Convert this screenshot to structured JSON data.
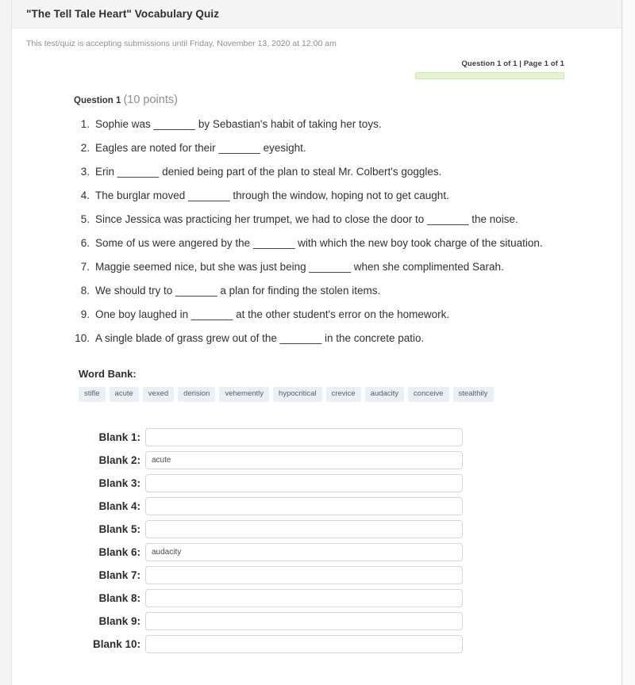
{
  "header": {
    "title": "\"The Tell Tale Heart\" Vocabulary Quiz",
    "submission_note": "This test/quiz is accepting submissions until Friday, November 13, 2020 at 12:00 am"
  },
  "progress": {
    "counter_label": "Question 1 of 1 | Page 1 of 1",
    "percent": 100,
    "fill_color": "#e4f4d2",
    "border_color": "#cfe8b3"
  },
  "question": {
    "number_label": "Question 1",
    "points_label": "(10 points)",
    "items": [
      "Sophie was  _______ by Sebastian's habit of taking her toys.",
      "Eagles are noted for their  _______ eyesight.",
      "Erin  _______ denied being part of the plan to steal Mr. Colbert's goggles.",
      "The burglar moved  _______ through the window, hoping not to get caught.",
      "Since Jessica was practicing her trumpet, we had to close the door to  _______ the noise.",
      "Some of us were angered by the  _______ with which the new boy took charge of the situation.",
      "Maggie seemed nice, but she was just being  _______ when she complimented Sarah.",
      "We should try to  _______ a plan for finding the stolen items.",
      "One boy laughed in  _______ at the other student's error on the homework.",
      "A single blade of grass grew out of the  _______ in the concrete patio."
    ]
  },
  "word_bank": {
    "title": "Word Bank:",
    "words": [
      "stifle",
      "acute",
      "vexed",
      "derision",
      "vehemently",
      "hypocritical",
      "crevice",
      "audacity",
      "conceive",
      "stealthily"
    ]
  },
  "blanks": [
    {
      "label": "Blank 1:",
      "value": ""
    },
    {
      "label": "Blank 2:",
      "value": "acute"
    },
    {
      "label": "Blank 3:",
      "value": ""
    },
    {
      "label": "Blank 4:",
      "value": ""
    },
    {
      "label": "Blank 5:",
      "value": ""
    },
    {
      "label": "Blank 6:",
      "value": "audacity"
    },
    {
      "label": "Blank 7:",
      "value": ""
    },
    {
      "label": "Blank 8:",
      "value": ""
    },
    {
      "label": "Blank 9:",
      "value": ""
    },
    {
      "label": "Blank 10:",
      "value": ""
    }
  ]
}
